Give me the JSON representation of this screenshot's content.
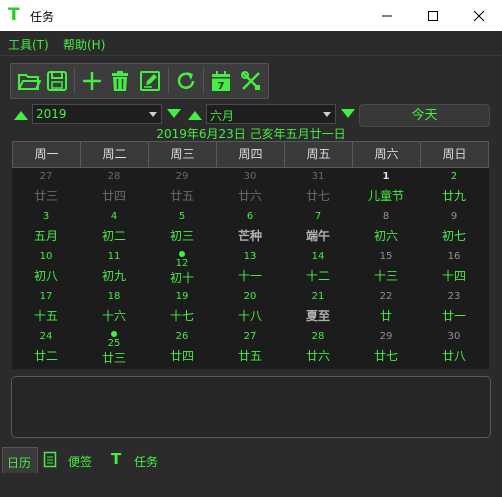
{
  "window": {
    "title": "任务"
  },
  "menu": [
    {
      "label": "工具(T)"
    },
    {
      "label": "帮助(H)"
    }
  ],
  "toolbar": {
    "icons": [
      "folder-open-icon",
      "save-icon",
      "add-icon",
      "trash-icon",
      "edit-icon",
      "refresh-icon",
      "calendar-icon",
      "tools-icon"
    ],
    "calendar_day": "7"
  },
  "selector": {
    "year": "2019",
    "month": "六月",
    "today_label": "今天"
  },
  "date_line": "2019年6月23日  己亥年五月廿一日",
  "weekdays": [
    "周一",
    "周二",
    "周三",
    "周四",
    "周五",
    "周六",
    "周日"
  ],
  "weeks": [
    [
      {
        "n": "27",
        "l": "廿三",
        "t": "dim"
      },
      {
        "n": "28",
        "l": "廿四",
        "t": "dim"
      },
      {
        "n": "29",
        "l": "廿五",
        "t": "dim"
      },
      {
        "n": "30",
        "l": "廿六",
        "t": "dim"
      },
      {
        "n": "31",
        "l": "廿七",
        "t": "dim"
      },
      {
        "n": "1",
        "l": "儿童节",
        "t": "fest1"
      },
      {
        "n": "2",
        "l": "廿九",
        "t": "cur"
      }
    ],
    [
      {
        "n": "3",
        "l": "五月",
        "t": "cur"
      },
      {
        "n": "4",
        "l": "初二",
        "t": "cur"
      },
      {
        "n": "5",
        "l": "初三",
        "t": "cur"
      },
      {
        "n": "6",
        "l": "芒种",
        "t": "term"
      },
      {
        "n": "7",
        "l": "端午",
        "t": "term"
      },
      {
        "n": "8",
        "l": "初六",
        "t": "curw"
      },
      {
        "n": "9",
        "l": "初七",
        "t": "curw"
      }
    ],
    [
      {
        "n": "10",
        "l": "初八",
        "t": "cur"
      },
      {
        "n": "11",
        "l": "初九",
        "t": "cur"
      },
      {
        "n": "12",
        "l": "初十",
        "t": "cur",
        "dot": true
      },
      {
        "n": "13",
        "l": "十一",
        "t": "cur"
      },
      {
        "n": "14",
        "l": "十二",
        "t": "cur"
      },
      {
        "n": "15",
        "l": "十三",
        "t": "curw"
      },
      {
        "n": "16",
        "l": "十四",
        "t": "curw"
      }
    ],
    [
      {
        "n": "17",
        "l": "十五",
        "t": "cur"
      },
      {
        "n": "18",
        "l": "十六",
        "t": "cur"
      },
      {
        "n": "19",
        "l": "十七",
        "t": "cur"
      },
      {
        "n": "20",
        "l": "十八",
        "t": "cur"
      },
      {
        "n": "21",
        "l": "夏至",
        "t": "term"
      },
      {
        "n": "22",
        "l": "廿",
        "t": "curw"
      },
      {
        "n": "23",
        "l": "廿一",
        "t": "curw"
      }
    ],
    [
      {
        "n": "24",
        "l": "廿二",
        "t": "cur"
      },
      {
        "n": "25",
        "l": "廿三",
        "t": "cur",
        "dot": true
      },
      {
        "n": "26",
        "l": "廿四",
        "t": "cur"
      },
      {
        "n": "27",
        "l": "廿五",
        "t": "cur"
      },
      {
        "n": "28",
        "l": "廿六",
        "t": "cur"
      },
      {
        "n": "29",
        "l": "廿七",
        "t": "curw"
      },
      {
        "n": "30",
        "l": "廿八",
        "t": "curw"
      }
    ]
  ],
  "tabs": [
    {
      "label": "日历"
    },
    {
      "label": "便签",
      "icon": "note-icon"
    },
    {
      "label": "任务",
      "icon": "task-icon"
    }
  ],
  "colors": {
    "accent": "#44ee44",
    "dim": "#6a6a6a",
    "term": "#b0b0b0",
    "bg": "#2b2b2b"
  }
}
